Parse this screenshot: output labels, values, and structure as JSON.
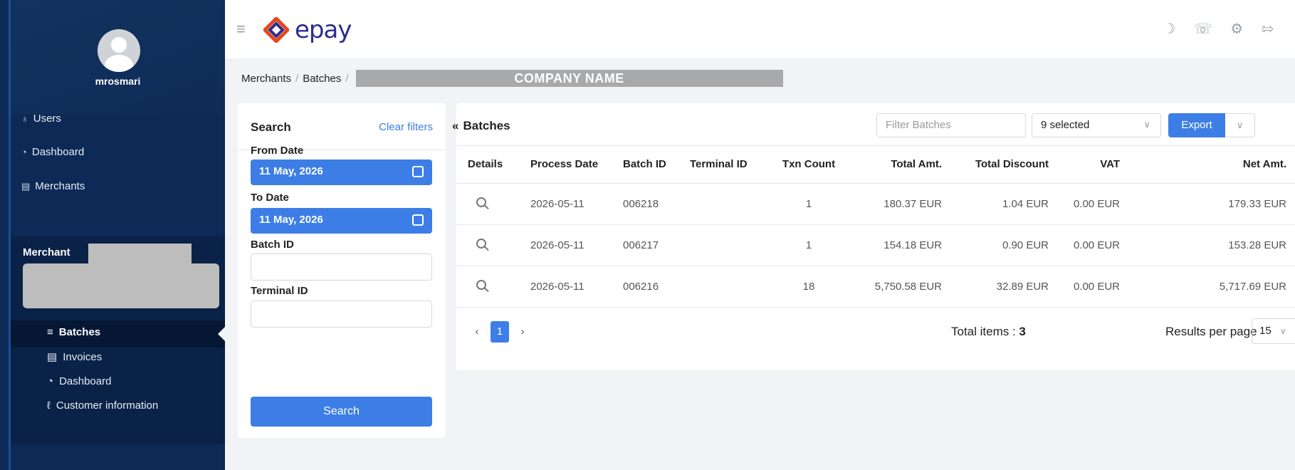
{
  "sidebar": {
    "username": "mrosmari",
    "items": [
      {
        "label": "Users",
        "icon": "users-icon"
      },
      {
        "label": "Dashboard",
        "icon": "dashboard-icon"
      },
      {
        "label": "Merchants",
        "icon": "merchants-icon"
      }
    ],
    "merchant_label": "Merchant",
    "sub_items": [
      {
        "label": "Batches",
        "icon": "stack-icon"
      },
      {
        "label": "Invoices",
        "icon": "document-icon"
      },
      {
        "label": "Dashboard",
        "icon": "dashboard-icon"
      },
      {
        "label": "Customer information",
        "icon": "person-icon"
      }
    ]
  },
  "topbar": {
    "logo_text": "epay",
    "icons": [
      "moon-icon",
      "phone-icon",
      "gear-icon",
      "logout-icon"
    ]
  },
  "breadcrumb": {
    "items": [
      "Merchants",
      "Batches"
    ],
    "company": "COMPANY NAME"
  },
  "search": {
    "title": "Search",
    "clear_label": "Clear filters",
    "from_label": "From Date",
    "from_value": "11 May, 2026",
    "to_label": "To Date",
    "to_value": "11 May, 2026",
    "batch_label": "Batch ID",
    "terminal_label": "Terminal ID",
    "button_label": "Search"
  },
  "batches": {
    "collapse_glyph": "«",
    "title": "Batches",
    "filter_placeholder": "Filter Batches",
    "selected_label": "9 selected",
    "export_label": "Export",
    "columns": [
      "Details",
      "Process Date",
      "Batch ID",
      "Terminal ID",
      "Txn Count",
      "Total Amt.",
      "Total Discount",
      "VAT",
      "Net Amt."
    ],
    "rows": [
      [
        "",
        "2026-05-11",
        "006218",
        "",
        "1",
        "180.37 EUR",
        "1.04 EUR",
        "0.00 EUR",
        "179.33 EUR"
      ],
      [
        "",
        "2026-05-11",
        "006217",
        "",
        "1",
        "154.18 EUR",
        "0.90 EUR",
        "0.00 EUR",
        "153.28 EUR"
      ],
      [
        "",
        "2026-05-11",
        "006216",
        "",
        "18",
        "5,750.58 EUR",
        "32.89 EUR",
        "0.00 EUR",
        "5,717.69 EUR"
      ]
    ],
    "page": "1",
    "total_label": "Total items : ",
    "total_value": "3",
    "rpp_label": "Results per page",
    "rpp_value": "15"
  },
  "colors": {
    "sidebar": "#0d2a56",
    "accent": "#3d7ee6",
    "logo": "#2c2d8f"
  }
}
